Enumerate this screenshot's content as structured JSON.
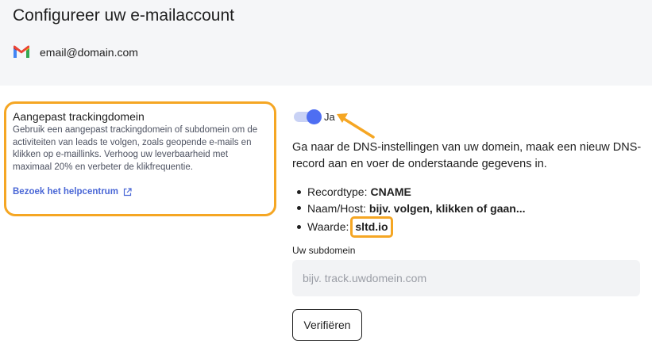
{
  "header": {
    "title": "Configureer uw e-mailaccount",
    "account_email": "email@domain.com",
    "account_icon": "gmail-icon"
  },
  "tracking_card": {
    "title": "Aangepast trackingdomein",
    "description": "Gebruik een aangepast trackingdomein of subdomein om de activiteiten van leads te volgen, zoals geopende e-mails en klikken op e-maillinks. Verhoog uw leverbaarheid met maximaal 20% en verbeter de klikfrequentie.",
    "help_link": "Bezoek het helpcentrum",
    "highlight_color": "#f5a623"
  },
  "toggle": {
    "label": "Ja",
    "enabled": true,
    "accent_color": "#4e6ef2"
  },
  "instructions": "Ga naar de DNS-instellingen van uw domein, maak een nieuw DNS-record aan en voer de onderstaande gegevens in.",
  "records": {
    "type_label": "Recordtype:",
    "type_value": "CNAME",
    "host_label": "Naam/Host:",
    "host_value": "bijv. volgen, klikken of gaan...",
    "value_label": "Waarde:",
    "value_value": "sltd.io"
  },
  "subdomain": {
    "label": "Uw subdomein",
    "value": "",
    "placeholder": "bijv. track.uwdomein.com"
  },
  "verify_button": "Verifiëren"
}
